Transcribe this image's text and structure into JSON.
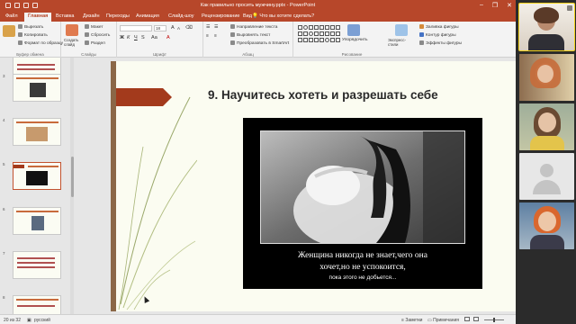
{
  "window": {
    "title": "Как правильно просить мужчину.pptx  -  PowerPoint",
    "minimize": "–",
    "restore": "❐",
    "close": "✕"
  },
  "tabs": [
    "Главная",
    "Вставка",
    "Дизайн",
    "Переходы",
    "Анимация",
    "Слайд-шоу",
    "Рецензирование",
    "Вид"
  ],
  "active_tab": "Главная",
  "file_tab": "Файл",
  "tell_me": "Что вы хотите сделать?",
  "ribbon": {
    "clipboard": {
      "cut": "Вырезать",
      "copy": "Копировать",
      "format_painter": "Формат по образцу",
      "label": "Буфер обмена"
    },
    "slides": {
      "create": "Создать слайд",
      "layout": "Макет",
      "reset": "Сбросить",
      "section": "Раздел",
      "label": "Слайды"
    },
    "font": {
      "size": "18",
      "label": "Шрифт",
      "buttons": [
        "Ж",
        "К",
        "Ч",
        "S",
        "Аа"
      ]
    },
    "paragraph": {
      "text_direction": "Направление текста",
      "align_text": "Выровнять текст",
      "smartart": "Преобразовать в SmartArt",
      "label": "Абзац"
    },
    "drawing": {
      "arrange": "Упорядочить",
      "quick_styles": "Экспресс-стили",
      "fill": "Заливка фигуры",
      "outline": "Контур фигуры",
      "effects": "Эффекты фигуры",
      "label": "Рисование"
    }
  },
  "slide": {
    "title": "9. Научитесь хотеть и разрешать себе",
    "poster_caption_line1": "Женщина никогда не знает,чего она",
    "poster_caption_line2": "хочет,но не успокоится,",
    "poster_caption_line3": "пока этого не добьется..."
  },
  "thumbnails": [
    {
      "num": "",
      "kind": "text"
    },
    {
      "num": "3",
      "kind": "image"
    },
    {
      "num": "4",
      "kind": "image"
    },
    {
      "num": "5",
      "kind": "image-selected"
    },
    {
      "num": "6",
      "kind": "image"
    },
    {
      "num": "7",
      "kind": "text"
    },
    {
      "num": "8",
      "kind": "text"
    }
  ],
  "status": {
    "slide_counter": "20 из 32",
    "language": "русский",
    "notes": "Заметки",
    "comments": "Примечания"
  },
  "colors": {
    "accent": "#b7472a",
    "slide_bg": "#fbfcf1",
    "slide_arrow": "#a33a1c",
    "active_speaker": "#f2d21b"
  },
  "video_participants": [
    {
      "id": "speaker",
      "active": true
    },
    {
      "id": "participant-2",
      "active": false
    },
    {
      "id": "participant-3",
      "active": false
    },
    {
      "id": "participant-4-no-video",
      "active": false
    },
    {
      "id": "participant-5",
      "active": false
    }
  ]
}
